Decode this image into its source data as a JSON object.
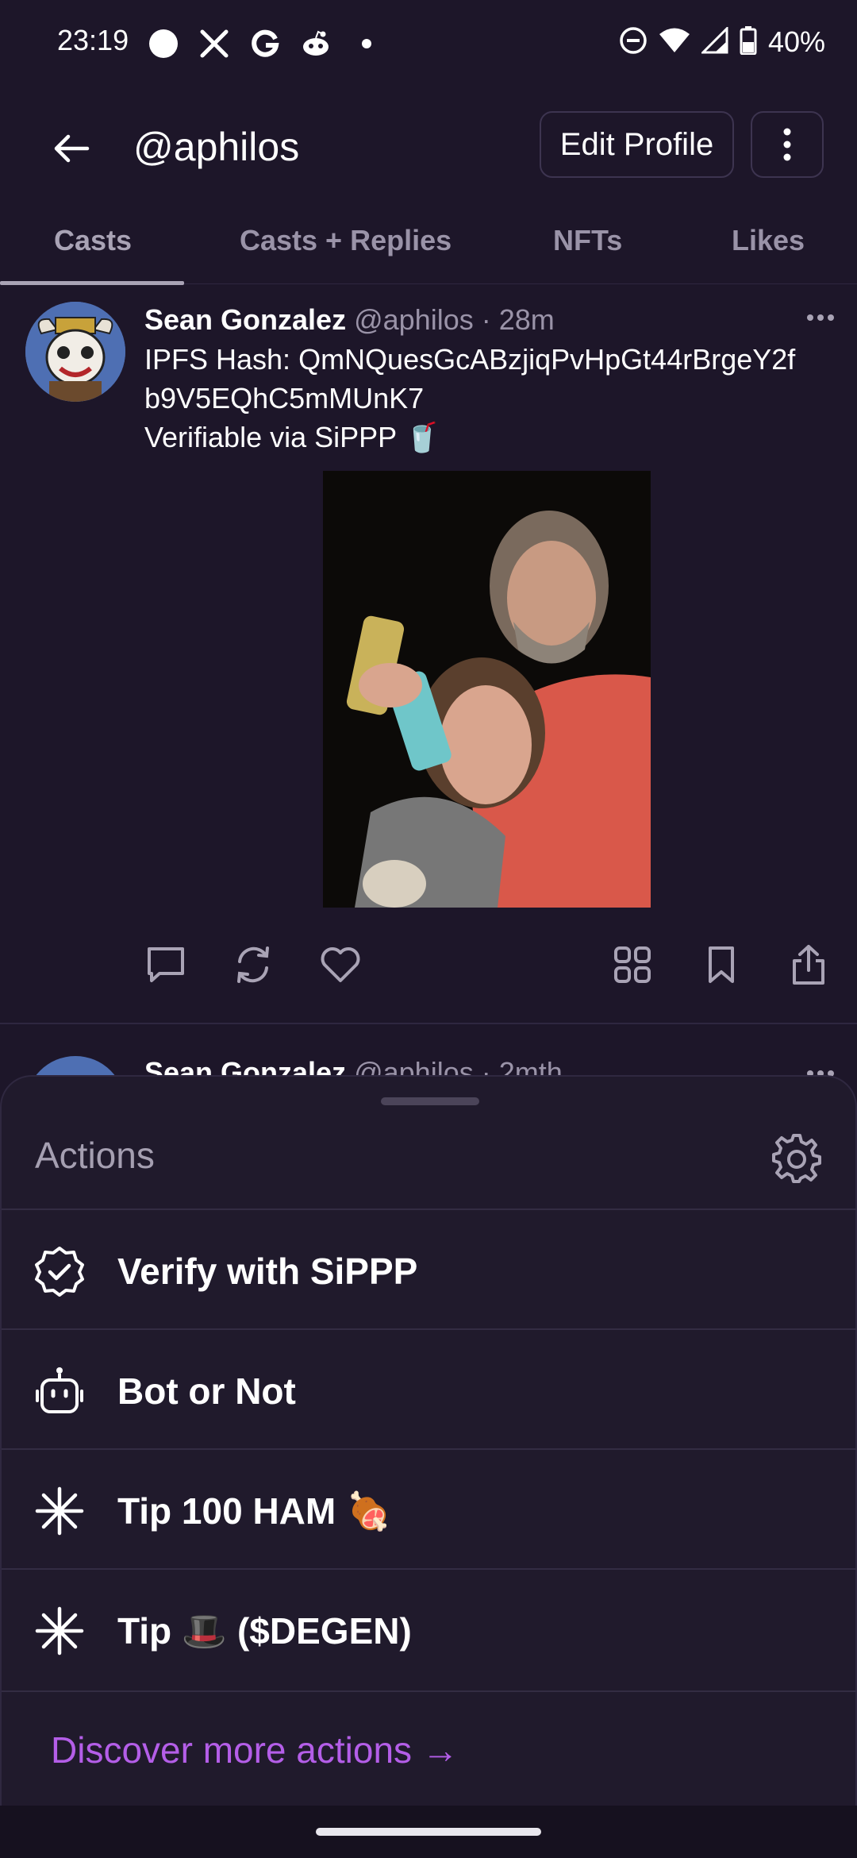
{
  "status_bar": {
    "time": "23:19",
    "notification_icons": [
      "circle-icon",
      "x-icon",
      "google-icon",
      "reddit-icon",
      "dot-icon"
    ],
    "system_icons": [
      "dnd-icon",
      "wifi-icon",
      "signal-icon",
      "battery-icon"
    ],
    "battery": "40%"
  },
  "header": {
    "title": "@aphilos",
    "edit_profile_label": "Edit Profile"
  },
  "tabs": [
    {
      "label": "Casts",
      "active": true
    },
    {
      "label": "Casts + Replies",
      "active": false
    },
    {
      "label": "NFTs",
      "active": false
    },
    {
      "label": "Likes",
      "active": false
    }
  ],
  "post": {
    "author": "Sean Gonzalez",
    "handle_time": "@aphilos · 28m",
    "text_line1": "IPFS Hash: QmNQuesGcABzjiqPvHpGt44rBrgeY2f",
    "text_line2": "b9V5EQhC5mMUnK7",
    "text_line3": "Verifiable via SiPPP 🥤",
    "image_alt": "Selfie of two people holding drink cans at night",
    "actions": [
      "comment-icon",
      "recast-icon",
      "like-icon",
      "apps-icon",
      "bookmark-icon",
      "share-icon"
    ]
  },
  "next_post": {
    "author": "Sean Gonzalez",
    "handle_time": "@aphilos · 2mth"
  },
  "actions_sheet": {
    "title": "Actions",
    "items": [
      {
        "label": "Verify with SiPPP",
        "icon": "verified-badge-icon"
      },
      {
        "label": "Bot or Not",
        "icon": "robot-icon"
      },
      {
        "label": "Tip 100 HAM 🍖",
        "icon": "asterisk-icon"
      },
      {
        "label": "Tip 🎩 ($DEGEN)",
        "icon": "asterisk-icon"
      }
    ],
    "discover_label": "Discover more actions →"
  },
  "colors": {
    "background": "#1d1629",
    "sheet": "#201a2c",
    "accent_link": "#b45ee8",
    "muted_text": "#9a93a8"
  }
}
